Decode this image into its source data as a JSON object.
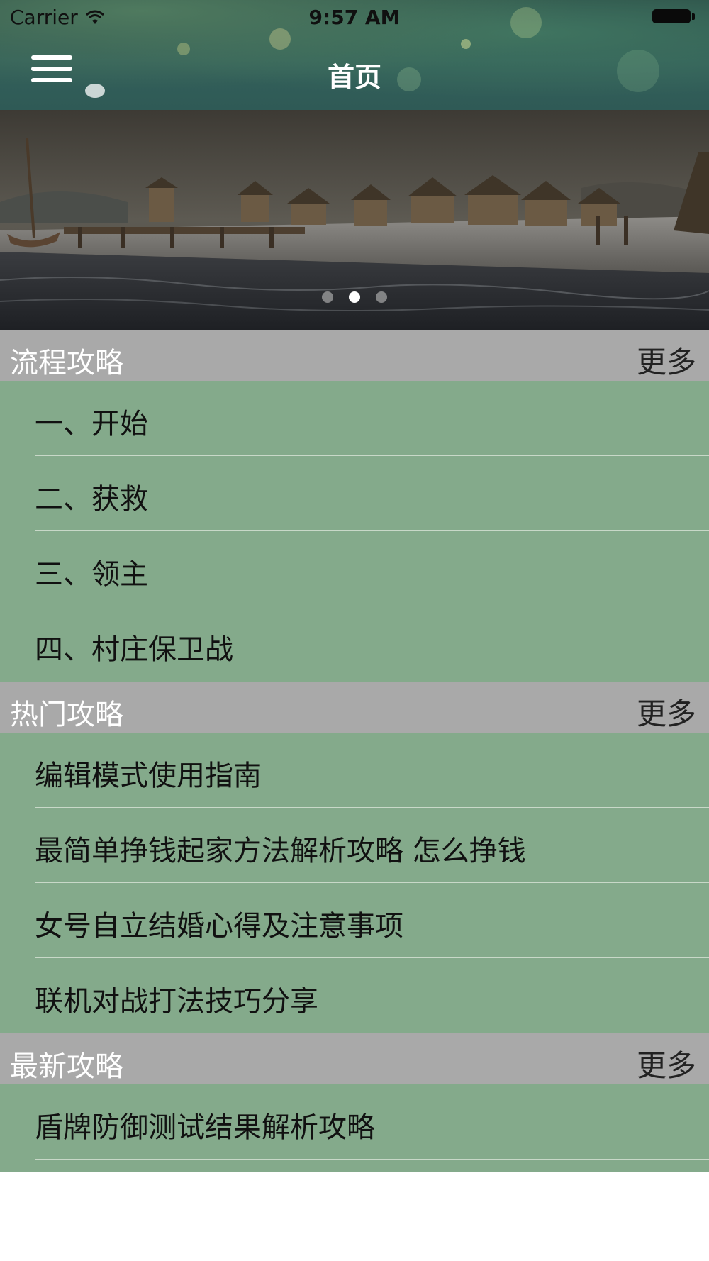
{
  "status_bar": {
    "carrier": "Carrier",
    "time": "9:57 AM"
  },
  "nav": {
    "title": "首页",
    "menu_icon": "hamburger-menu-icon"
  },
  "banner": {
    "page_count": 3,
    "active_index": 1
  },
  "sections": [
    {
      "title": "流程攻略",
      "more_label": "更多",
      "items": [
        "一、开始",
        "二、获救",
        "三、领主",
        "四、村庄保卫战"
      ]
    },
    {
      "title": "热门攻略",
      "more_label": "更多",
      "items": [
        "编辑模式使用指南",
        "最简单挣钱起家方法解析攻略 怎么挣钱",
        "女号自立结婚心得及注意事项",
        "联机对战打法技巧分享"
      ]
    },
    {
      "title": "最新攻略",
      "more_label": "更多",
      "items": [
        "盾牌防御测试结果解析攻略"
      ]
    }
  ],
  "colors": {
    "section_header_bg": "#a9a9a9",
    "list_bg": "#84aa8b",
    "nav_text": "#ffffff"
  }
}
